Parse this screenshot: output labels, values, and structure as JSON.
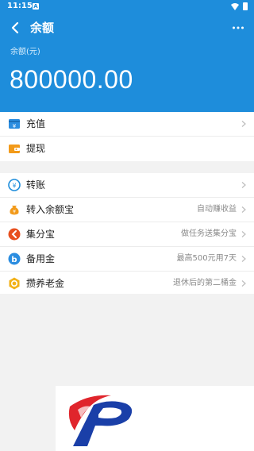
{
  "status_bar": {
    "time": "11:15",
    "notification": "A"
  },
  "header": {
    "title": "余额",
    "balance_label": "余额(元)",
    "balance_value": "800000.00"
  },
  "group1": [
    {
      "label": "充值",
      "icon": "recharge-icon",
      "hint": ""
    },
    {
      "label": "提现",
      "icon": "wallet-icon",
      "hint": ""
    }
  ],
  "group2": [
    {
      "label": "转账",
      "icon": "transfer-icon",
      "hint": ""
    },
    {
      "label": "转入余额宝",
      "icon": "money-bag-icon",
      "hint": "自动赚收益"
    },
    {
      "label": "集分宝",
      "icon": "points-icon",
      "hint": "做任务送集分宝"
    },
    {
      "label": "备用金",
      "icon": "reserve-icon",
      "hint": "最高500元用7天"
    },
    {
      "label": "攒养老金",
      "icon": "pension-icon",
      "hint": "退休后的第二桶金"
    }
  ],
  "colors": {
    "primary": "#1e8ddb",
    "recharge": "#2b8de0",
    "wallet": "#f29a1a",
    "transfer": "#1e8ddb",
    "money_bag": "#f29a1a",
    "points": "#e8501f",
    "reserve": "#2b8de0",
    "pension": "#f2b21a"
  }
}
